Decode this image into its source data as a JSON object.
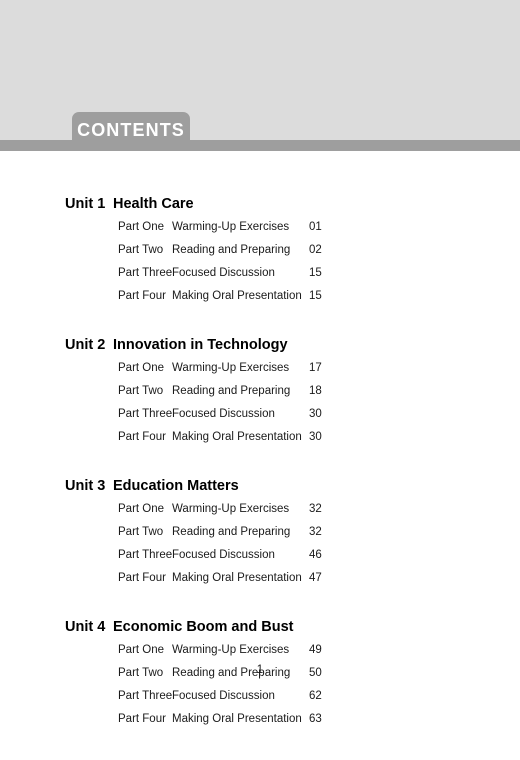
{
  "header": {
    "tab_label": "CONTENTS",
    "band_color": "#dcdcdc",
    "rule_color": "#9e9e9e",
    "tab_color": "#9e9e9e",
    "tab_text_color": "#ffffff"
  },
  "toc": {
    "units": [
      {
        "number": "Unit 1",
        "title": "Health Care",
        "parts": [
          {
            "label": "Part One",
            "title": "Warming-Up Exercises",
            "page": "01"
          },
          {
            "label": "Part Two",
            "title": "Reading and Preparing",
            "page": "02"
          },
          {
            "label": "Part Three",
            "title": "Focused Discussion",
            "page": "15"
          },
          {
            "label": "Part Four",
            "title": "Making Oral Presentation",
            "page": "15"
          }
        ]
      },
      {
        "number": "Unit 2",
        "title": "Innovation in Technology",
        "parts": [
          {
            "label": "Part One",
            "title": "Warming-Up Exercises",
            "page": "17"
          },
          {
            "label": "Part Two",
            "title": "Reading and Preparing",
            "page": "18"
          },
          {
            "label": "Part Three",
            "title": "Focused Discussion",
            "page": "30"
          },
          {
            "label": "Part Four",
            "title": "Making Oral Presentation",
            "page": "30"
          }
        ]
      },
      {
        "number": "Unit 3",
        "title": "Education Matters",
        "parts": [
          {
            "label": "Part One",
            "title": "Warming-Up Exercises",
            "page": "32"
          },
          {
            "label": "Part Two",
            "title": "Reading and Preparing",
            "page": "32"
          },
          {
            "label": "Part Three",
            "title": "Focused Discussion",
            "page": "46"
          },
          {
            "label": "Part Four",
            "title": "Making Oral Presentation",
            "page": "47"
          }
        ]
      },
      {
        "number": "Unit 4",
        "title": "Economic Boom and Bust",
        "parts": [
          {
            "label": "Part One",
            "title": "Warming-Up Exercises",
            "page": "49"
          },
          {
            "label": "Part Two",
            "title": "Reading and Preparing",
            "page": "50"
          },
          {
            "label": "Part Three",
            "title": "Focused Discussion",
            "page": "62"
          },
          {
            "label": "Part Four",
            "title": "Making Oral Presentation",
            "page": "63"
          }
        ]
      }
    ]
  },
  "footer": {
    "page_number": "1"
  }
}
